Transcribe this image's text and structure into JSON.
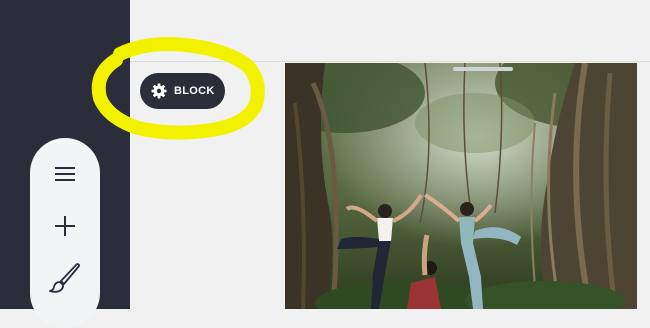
{
  "block_button": {
    "label": "BLOCK",
    "icon": "gear-icon"
  },
  "toolbar": {
    "items": [
      {
        "name": "menu",
        "icon": "hamburger-menu-icon"
      },
      {
        "name": "add",
        "icon": "plus-icon"
      },
      {
        "name": "style",
        "icon": "paintbrush-icon"
      }
    ]
  },
  "colors": {
    "sidebar": "#2b2d3a",
    "canvas": "#f1f1f1",
    "toolbar_pill": "#f3f4f6",
    "highlight_annotation": "#f2f200"
  }
}
